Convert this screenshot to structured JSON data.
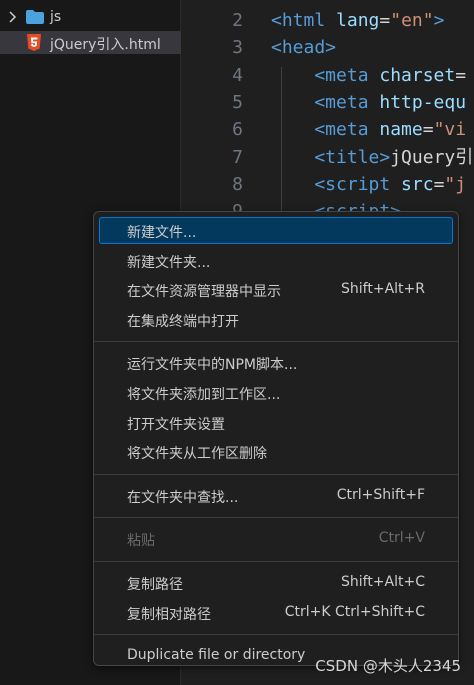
{
  "explorer": {
    "folder_label": "js",
    "file_label": "jQuery引入.html"
  },
  "editor": {
    "lines": [
      {
        "num": "2",
        "parts": [
          {
            "t": "<html ",
            "c": "tag"
          },
          {
            "t": "lang",
            "c": "attr"
          },
          {
            "t": "=",
            "c": "plain"
          },
          {
            "t": "\"en\"",
            "c": "str"
          },
          {
            "t": ">",
            "c": "tag"
          }
        ]
      },
      {
        "num": "3",
        "parts": [
          {
            "t": "<head>",
            "c": "tag"
          }
        ]
      },
      {
        "num": "4",
        "parts": [
          {
            "t": "    <meta ",
            "c": "tag"
          },
          {
            "t": "charset",
            "c": "attr"
          },
          {
            "t": "=",
            "c": "plain"
          }
        ]
      },
      {
        "num": "5",
        "parts": [
          {
            "t": "    <meta ",
            "c": "tag"
          },
          {
            "t": "http-equ",
            "c": "attr"
          }
        ]
      },
      {
        "num": "6",
        "parts": [
          {
            "t": "    <meta ",
            "c": "tag"
          },
          {
            "t": "name",
            "c": "attr"
          },
          {
            "t": "=",
            "c": "plain"
          },
          {
            "t": "\"vi",
            "c": "str"
          }
        ]
      },
      {
        "num": "7",
        "parts": [
          {
            "t": "    <title>",
            "c": "tag"
          },
          {
            "t": "jQuery引",
            "c": "plain"
          }
        ]
      },
      {
        "num": "8",
        "parts": [
          {
            "t": "    <script ",
            "c": "tag"
          },
          {
            "t": "src",
            "c": "attr"
          },
          {
            "t": "=",
            "c": "plain"
          },
          {
            "t": "\"j",
            "c": "str"
          }
        ]
      },
      {
        "num": "9",
        "parts": [
          {
            "t": "    <script>",
            "c": "tag"
          }
        ]
      }
    ]
  },
  "context_menu": {
    "groups": [
      [
        {
          "label": "新建文件...",
          "shortcut": "",
          "active": true,
          "disabled": false,
          "name": "menu-item-new-file"
        },
        {
          "label": "新建文件夹...",
          "shortcut": "",
          "active": false,
          "disabled": false,
          "name": "menu-item-new-folder"
        },
        {
          "label": "在文件资源管理器中显示",
          "shortcut": "Shift+Alt+R",
          "active": false,
          "disabled": false,
          "name": "menu-item-reveal-in-explorer"
        },
        {
          "label": "在集成终端中打开",
          "shortcut": "",
          "active": false,
          "disabled": false,
          "name": "menu-item-open-in-terminal"
        }
      ],
      [
        {
          "label": "运行文件夹中的NPM脚本...",
          "shortcut": "",
          "active": false,
          "disabled": false,
          "name": "menu-item-run-npm-scripts"
        },
        {
          "label": "将文件夹添加到工作区...",
          "shortcut": "",
          "active": false,
          "disabled": false,
          "name": "menu-item-add-folder-to-workspace"
        },
        {
          "label": "打开文件夹设置",
          "shortcut": "",
          "active": false,
          "disabled": false,
          "name": "menu-item-open-folder-settings"
        },
        {
          "label": "将文件夹从工作区删除",
          "shortcut": "",
          "active": false,
          "disabled": false,
          "name": "menu-item-remove-folder-from-workspace"
        }
      ],
      [
        {
          "label": "在文件夹中查找...",
          "shortcut": "Ctrl+Shift+F",
          "active": false,
          "disabled": false,
          "name": "menu-item-find-in-folder"
        }
      ],
      [
        {
          "label": "粘贴",
          "shortcut": "Ctrl+V",
          "active": false,
          "disabled": true,
          "name": "menu-item-paste"
        }
      ],
      [
        {
          "label": "复制路径",
          "shortcut": "Shift+Alt+C",
          "active": false,
          "disabled": false,
          "name": "menu-item-copy-path"
        },
        {
          "label": "复制相对路径",
          "shortcut": "Ctrl+K Ctrl+Shift+C",
          "active": false,
          "disabled": false,
          "name": "menu-item-copy-relative-path"
        }
      ],
      [
        {
          "label": "Duplicate file or directory",
          "shortcut": "",
          "active": false,
          "disabled": false,
          "name": "menu-item-duplicate"
        }
      ]
    ]
  },
  "watermark": "CSDN @木头人2345",
  "colors": {
    "menu_active_bg": "#04395e",
    "menu_active_border": "#0078d4",
    "folder_icon": "#4aa3df",
    "html5_icon": "#e44d26",
    "tag": "#569cd6",
    "attr": "#9cdcfe",
    "string": "#ce9178"
  }
}
